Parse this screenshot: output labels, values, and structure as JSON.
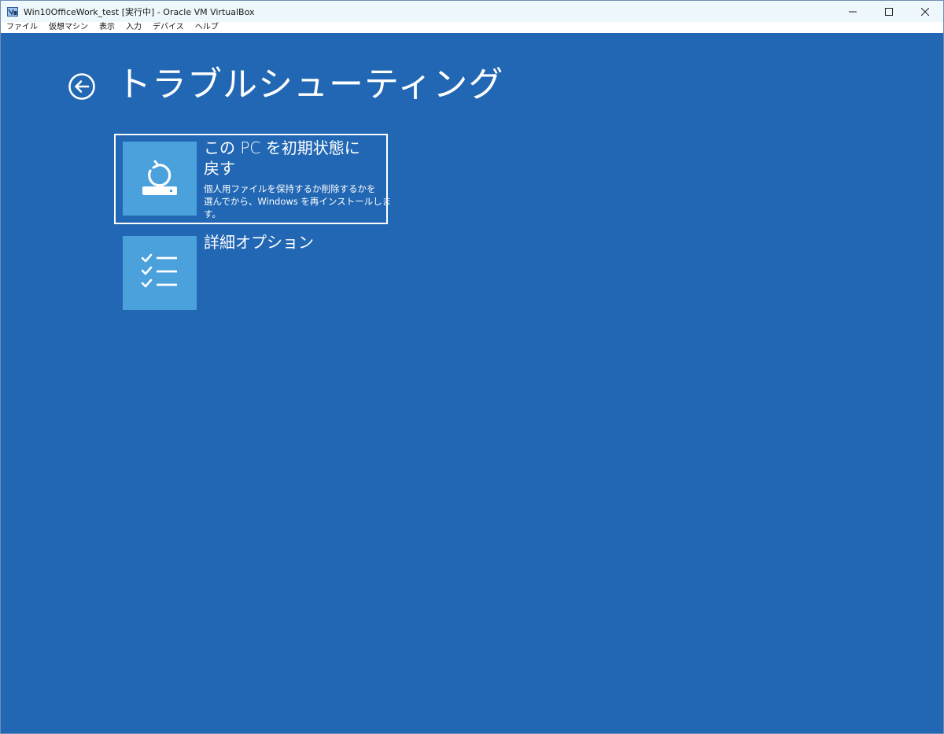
{
  "window": {
    "title": "Win10OfficeWork_test [実行中] - Oracle VM VirtualBox",
    "app_icon": "virtualbox-icon",
    "controls": {
      "minimize_icon": "minimize-icon",
      "maximize_icon": "maximize-icon",
      "close_icon": "close-icon"
    }
  },
  "menu": {
    "items": [
      "ファイル",
      "仮想マシン",
      "表示",
      "入力",
      "デバイス",
      "ヘルプ"
    ]
  },
  "screen": {
    "background_color": "#2167b3",
    "tile_color": "#4aa1dc",
    "back_icon": "back-arrow-icon",
    "title": "トラブルシューティング",
    "options": [
      {
        "heading_line1": "この PC を初期状態に",
        "heading_line2": "戻す",
        "desc_line1": "個人用ファイルを保持するか削除するかを",
        "desc_line2": "選んでから、Windows を再インストールしま",
        "desc_line3": "す。",
        "icon": "reset-pc-icon",
        "selected": true
      },
      {
        "heading_line1": "詳細オプション",
        "icon": "checklist-icon",
        "selected": false
      }
    ]
  }
}
